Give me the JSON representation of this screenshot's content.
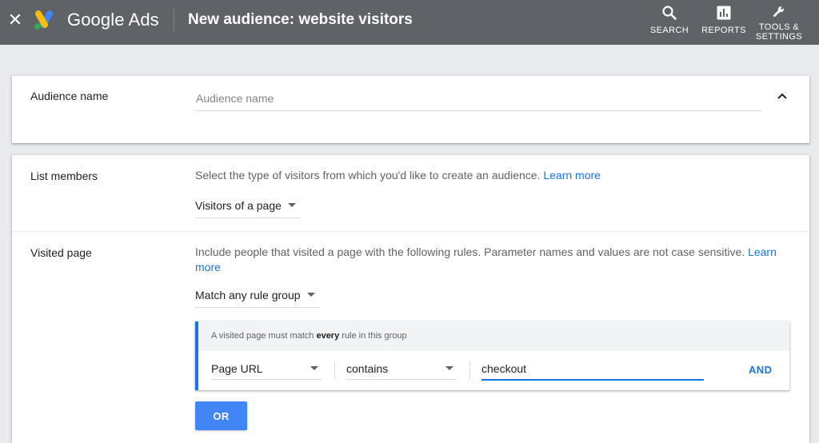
{
  "header": {
    "close_icon": "close-icon",
    "brand": "Google Ads",
    "title": "New audience: website visitors",
    "nav": [
      {
        "label": "SEARCH",
        "icon": "search-icon"
      },
      {
        "label": "REPORTS",
        "icon": "reports-icon"
      },
      {
        "label": "TOOLS & SETTINGS",
        "icon": "wrench-icon"
      }
    ]
  },
  "audience_name": {
    "label": "Audience name",
    "placeholder": "Audience name",
    "value": ""
  },
  "list_members": {
    "label": "List members",
    "helper": "Select the type of visitors from which you'd like to create an audience.",
    "learn_more": "Learn more",
    "selected": "Visitors of a page"
  },
  "visited_page": {
    "label": "Visited page",
    "helper": "Include people that visited a page with the following rules. Parameter names and values are not case sensitive.",
    "learn_more": "Learn more",
    "match_selected": "Match any rule group",
    "rule_group": {
      "header_prefix": "A visited page must match ",
      "header_emphasis": "every",
      "header_suffix": " rule in this group",
      "rules": [
        {
          "field": "Page URL",
          "operator": "contains",
          "value": "checkout"
        }
      ],
      "and_label": "AND"
    },
    "or_label": "OR"
  },
  "colors": {
    "topbar": "#5f6368",
    "accent": "#1a73e8",
    "or_button": "#4285f4"
  }
}
